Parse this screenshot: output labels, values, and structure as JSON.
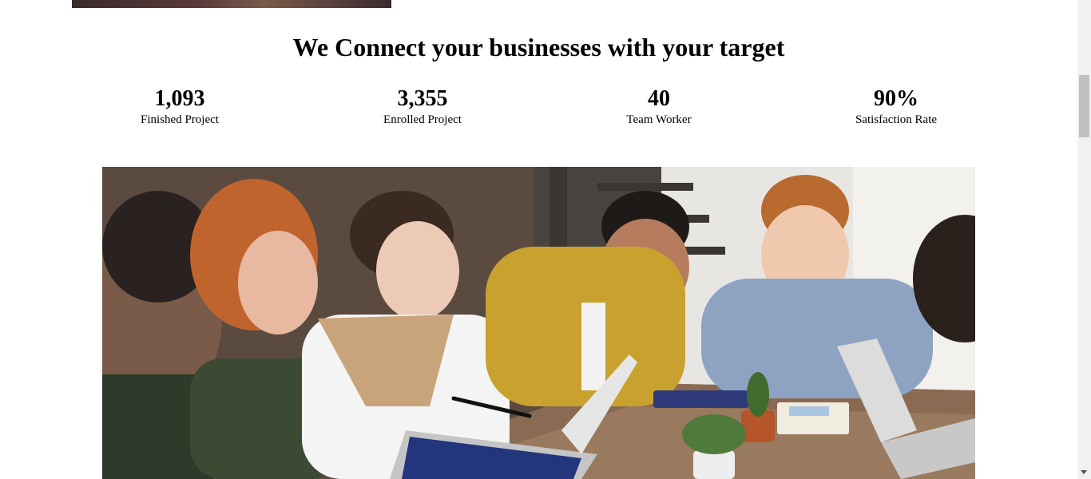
{
  "section": {
    "heading": "We Connect your businesses with your target"
  },
  "stats": [
    {
      "value": "1,093",
      "label": "Finished Project"
    },
    {
      "value": "3,355",
      "label": "Enrolled Project"
    },
    {
      "value": "40",
      "label": "Team Worker"
    },
    {
      "value": "90%",
      "label": "Satisfaction Rate"
    }
  ]
}
